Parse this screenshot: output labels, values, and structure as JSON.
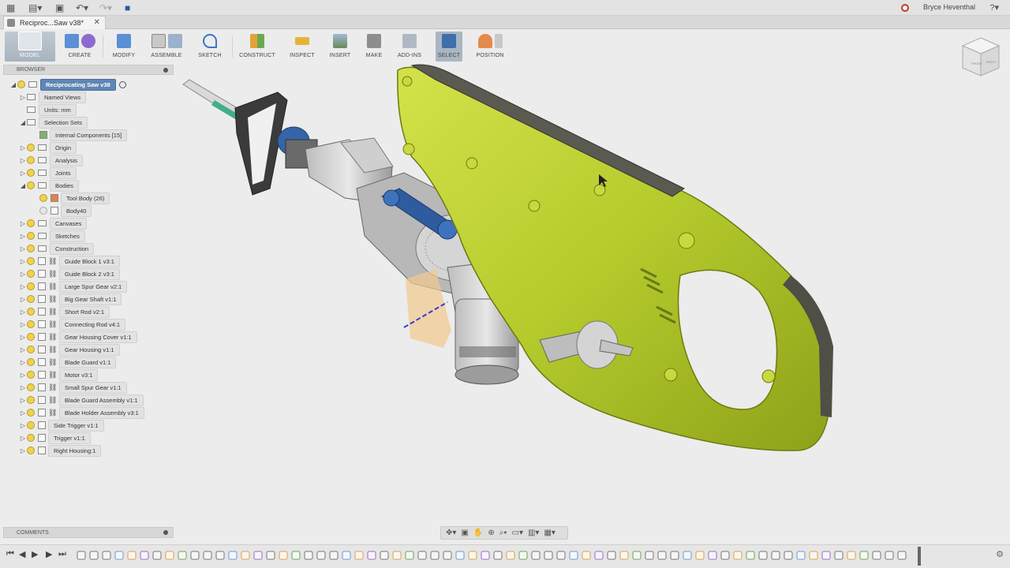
{
  "appbar": {
    "user": "Bryce Heventhal",
    "help": "?"
  },
  "tab": {
    "title": "Reciproc...Saw v38*"
  },
  "toolbar": {
    "groups": [
      "MODEL",
      "CREATE",
      "MODIFY",
      "ASSEMBLE",
      "SKETCH",
      "CONSTRUCT",
      "INSPECT",
      "INSERT",
      "MAKE",
      "ADD-INS",
      "SELECT",
      "POSITION"
    ]
  },
  "browser": {
    "title": "BROWSER",
    "root": "Reciprocating Saw v38",
    "items": [
      "Named Views",
      "Units: mm",
      "Selection Sets",
      "Internal Components [15]",
      "Origin",
      "Analysis",
      "Joints",
      "Bodies",
      "Tool Body (26)",
      "Body40",
      "Canvases",
      "Sketches",
      "Construction",
      "Guide Block 1 v3:1",
      "Guide Block 2 v3:1",
      "Large Spur Gear v2:1",
      "Big Gear Shaft v1:1",
      "Short Rod v2:1",
      "Connecting Rod v4:1",
      "Gear Housing Cover v1:1",
      "Gear Housing v1:1",
      "Blade Guard v1:1",
      "Motor v3:1",
      "Small Spur Gear  v1:1",
      "Blade Guard Assembly v1:1",
      "Blade Holder Assembly v3:1",
      "Side Trigger v1:1",
      "Trigger v1:1",
      "Right Housing:1"
    ]
  },
  "comments": {
    "title": "COMMENTS"
  },
  "viewcube": {
    "front": "FRONT",
    "right": "RIGHT"
  },
  "colors": {
    "housing": "#b9cf2e",
    "accent": "#5f86b6"
  }
}
